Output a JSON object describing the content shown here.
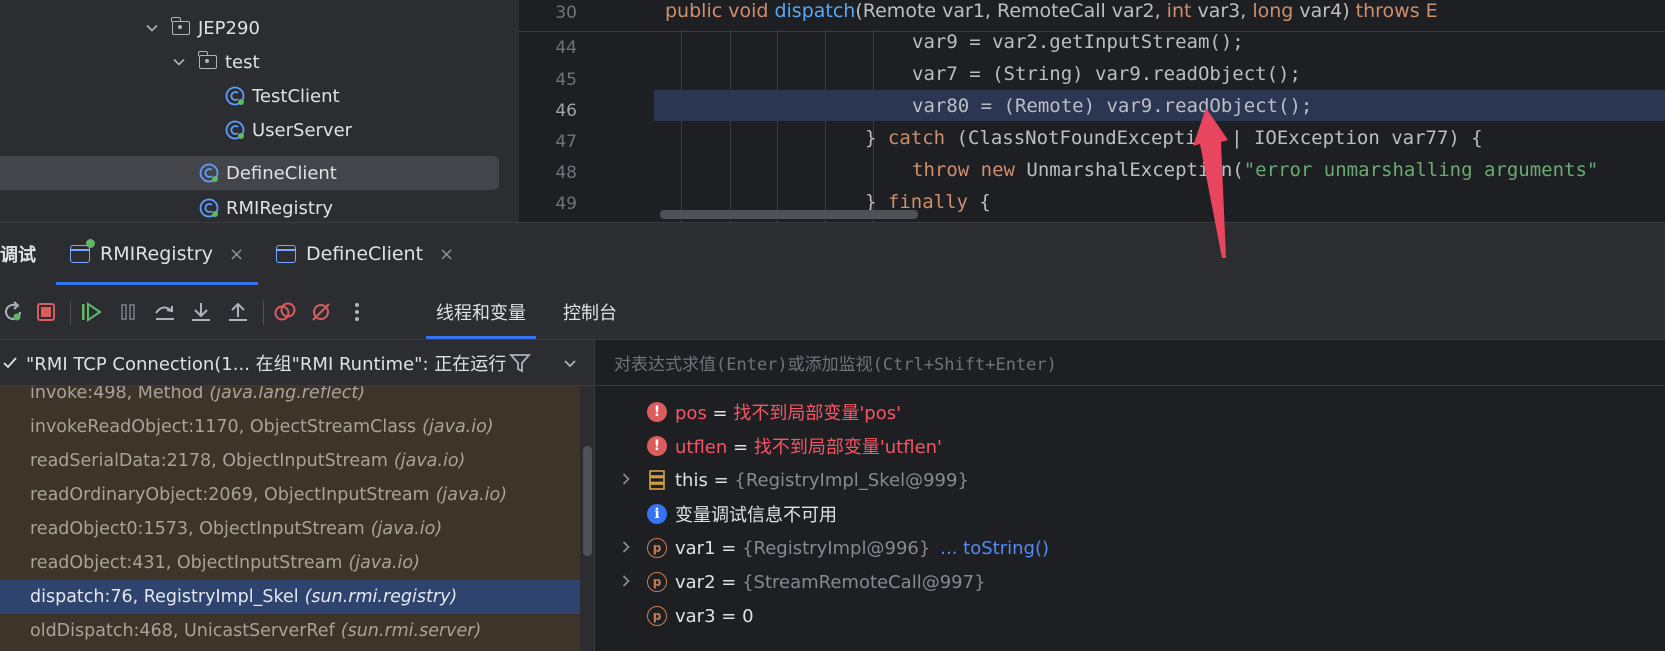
{
  "project_tree": {
    "items": [
      {
        "label": "JEP290",
        "icon": "package-folder-icon",
        "expanded": true
      },
      {
        "label": "test",
        "icon": "package-folder-icon",
        "expanded": true
      },
      {
        "label": "TestClient",
        "icon": "java-class-icon"
      },
      {
        "label": "UserServer",
        "icon": "java-class-icon"
      },
      {
        "label": "DefineClient",
        "icon": "java-class-icon",
        "selected": true
      },
      {
        "label": "RMIRegistry",
        "icon": "java-class-icon"
      }
    ]
  },
  "editor": {
    "sticky_line": {
      "number": "30",
      "parts": [
        {
          "t": "public ",
          "c": "kw"
        },
        {
          "t": "void ",
          "c": "kw"
        },
        {
          "t": "dispatch",
          "c": "fn"
        },
        {
          "t": "(Remote var1, RemoteCall var2, ",
          "c": ""
        },
        {
          "t": "int ",
          "c": "kw"
        },
        {
          "t": "var3, ",
          "c": ""
        },
        {
          "t": "long ",
          "c": "kw"
        },
        {
          "t": "var4) ",
          "c": ""
        },
        {
          "t": "throws E",
          "c": "kw"
        }
      ]
    },
    "lines": [
      {
        "number": "44",
        "parts": [
          {
            "t": "var9 = var2.getInputStream();",
            "c": ""
          }
        ]
      },
      {
        "number": "45",
        "parts": [
          {
            "t": "var7 = (String) var9.readObject();",
            "c": ""
          }
        ]
      },
      {
        "number": "46",
        "current": true,
        "parts": [
          {
            "t": "var80 = (Remote) var9.readObject();",
            "c": ""
          }
        ]
      },
      {
        "number": "47",
        "parts": [
          {
            "t": "} ",
            "c": ""
          },
          {
            "t": "catch ",
            "c": "kw"
          },
          {
            "t": "(ClassNotFoundException | IOException var77) {",
            "c": ""
          }
        ]
      },
      {
        "number": "48",
        "parts": [
          {
            "t": "throw new ",
            "c": "kw"
          },
          {
            "t": "UnmarshalException(",
            "c": ""
          },
          {
            "t": "\"error unmarshalling arguments\"",
            "c": "str"
          }
        ]
      },
      {
        "number": "49",
        "parts": [
          {
            "t": "} ",
            "c": ""
          },
          {
            "t": "finally ",
            "c": "kw"
          },
          {
            "t": "{",
            "c": ""
          }
        ]
      }
    ]
  },
  "debug": {
    "label": "调试",
    "tabs": [
      {
        "label": "RMIRegistry",
        "active": true
      },
      {
        "label": "DefineClient",
        "active": false
      }
    ],
    "close_glyph": "×",
    "subtabs": [
      {
        "label": "线程和变量",
        "active": true
      },
      {
        "label": "控制台",
        "active": false
      }
    ],
    "thread_status": "\"RMI TCP Connection(1... 在组\"RMI Runtime\": 正在运行",
    "frames": [
      {
        "method": "invoke:498, Method",
        "pkg": "(java.lang.reflect)"
      },
      {
        "method": "invokeReadObject:1170, ObjectStreamClass",
        "pkg": "(java.io)"
      },
      {
        "method": "readSerialData:2178, ObjectInputStream",
        "pkg": "(java.io)"
      },
      {
        "method": "readOrdinaryObject:2069, ObjectInputStream",
        "pkg": "(java.io)"
      },
      {
        "method": "readObject0:1573, ObjectInputStream",
        "pkg": "(java.io)"
      },
      {
        "method": "readObject:431, ObjectInputStream",
        "pkg": "(java.io)"
      },
      {
        "method": "dispatch:76, RegistryImpl_Skel",
        "pkg": "(sun.rmi.registry)",
        "selected": true
      },
      {
        "method": "oldDispatch:468, UnicastServerRef",
        "pkg": "(sun.rmi.server)"
      }
    ],
    "eval_placeholder": "对表达式求值(Enter)或添加监视(Ctrl+Shift+Enter)",
    "variables": {
      "pos": {
        "name": "pos",
        "eq": " = ",
        "value": "找不到局部变量'pos'"
      },
      "utflen": {
        "name": "utflen",
        "eq": " = ",
        "value": "找不到局部变量'utflen'"
      },
      "this": {
        "name": "this",
        "eq": " = ",
        "value": "{RegistryImpl_Skel@999}"
      },
      "info": {
        "text": "变量调试信息不可用"
      },
      "var1": {
        "name": "var1",
        "eq": " = ",
        "value": "{RegistryImpl@996}",
        "link": "... toString()"
      },
      "var2": {
        "name": "var2",
        "eq": " = ",
        "value": "{StreamRemoteCall@997}"
      },
      "var3": {
        "name": "var3",
        "eq": " = ",
        "value": "0"
      }
    }
  },
  "colors": {
    "accent": "#3574f0",
    "selection_current_line": "#2b3652",
    "frame_bg": "#3e3429",
    "arrow": "#e8455f"
  }
}
